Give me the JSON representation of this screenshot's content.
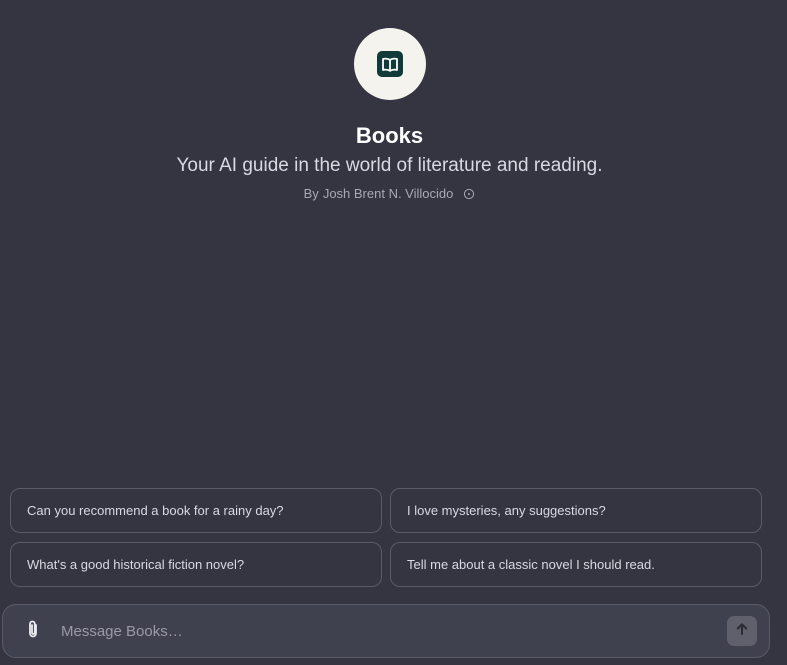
{
  "gpt": {
    "name": "Books",
    "description": "Your AI guide in the world of literature and reading.",
    "author_prefix": "By",
    "author_name": "Josh Brent N. Villocido",
    "logo_icon": "open-book-icon"
  },
  "suggestions": [
    "Can you recommend a book for a rainy day?",
    "I love mysteries, any suggestions?",
    "What's a good historical fiction novel?",
    "Tell me about a classic novel I should read."
  ],
  "composer": {
    "placeholder": "Message Books…",
    "value": "",
    "attach_icon": "paperclip-icon",
    "send_icon": "arrow-up-icon"
  },
  "colors": {
    "background": "#343541",
    "logo_bg": "#f5f3ee",
    "logo_fg": "#123a3a",
    "border": "#5a5b66"
  }
}
